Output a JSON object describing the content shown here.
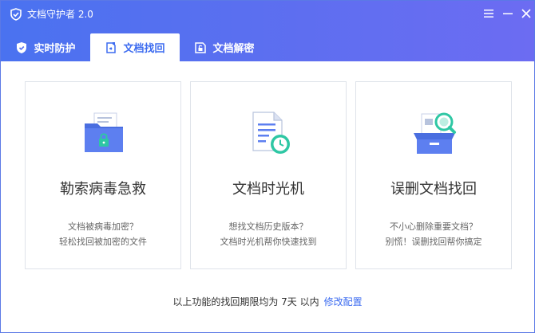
{
  "titlebar": {
    "title": "文档守护者 2.0",
    "logo_icon": "shield-logo-icon",
    "buttons": [
      "menu-icon",
      "minimize-icon",
      "close-icon"
    ]
  },
  "tabs": [
    {
      "label": "实时防护",
      "icon": "shield-icon",
      "active": false
    },
    {
      "label": "文档找回",
      "icon": "document-recover-icon",
      "active": true
    },
    {
      "label": "文档解密",
      "icon": "document-unlock-icon",
      "active": false
    }
  ],
  "cards": [
    {
      "title": "勒索病毒急救",
      "desc_line1": "文档被病毒加密？",
      "desc_line2": "轻松找回被加密的文件",
      "icon": "locked-folder-icon"
    },
    {
      "title": "文档时光机",
      "desc_line1": "想找文档历史版本？",
      "desc_line2": "文档时光机帮你快速找到",
      "icon": "document-clock-icon"
    },
    {
      "title": "误删文档找回",
      "desc_line1": "不小心删除重要文档？",
      "desc_line2": "别慌！误删找回帮你搞定",
      "icon": "box-search-icon"
    }
  ],
  "footer": {
    "text": "以上功能的找回期限均为 7天 以内",
    "link": "修改配置"
  },
  "colors": {
    "header_start": "#4a72f0",
    "header_end": "#6c6cf2",
    "accent": "#3d6cf0",
    "icon_green": "#2ec7a4",
    "card_border": "#dfe3ea"
  }
}
